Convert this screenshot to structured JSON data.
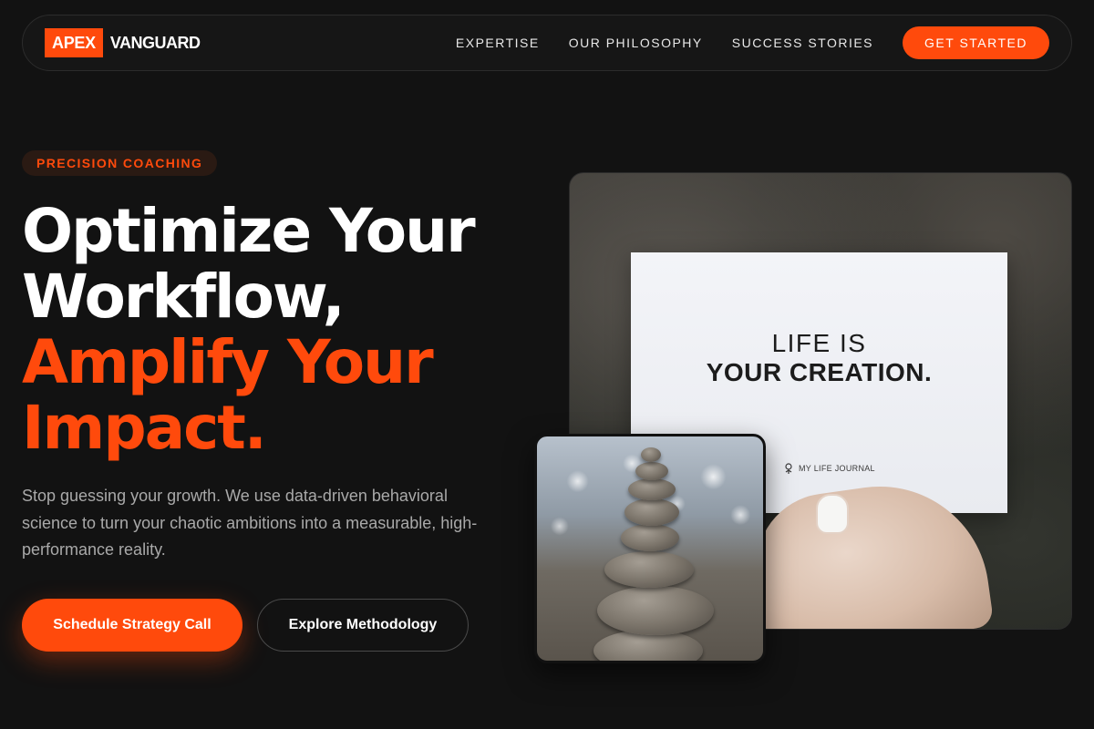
{
  "nav": {
    "logo_mark": "APEX",
    "logo_word": "VANGUARD",
    "links": [
      "EXPERTISE",
      "OUR PHILOSOPHY",
      "SUCCESS STORIES"
    ],
    "cta": "GET STARTED"
  },
  "hero": {
    "badge": "PRECISION COACHING",
    "headline": {
      "line1": "Optimize Your",
      "line2": "Workflow,",
      "line3": "Amplify Your",
      "line4": "Impact."
    },
    "lead": "Stop guessing your growth. We use data-driven behavioral science to turn your chaotic ambitions into a measurable, high-performance reality.",
    "primary_button": "Schedule Strategy Call",
    "secondary_button": "Explore Methodology"
  },
  "images": {
    "card_line1": "LIFE IS",
    "card_line2": "YOUR CREATION.",
    "card_brand": "MY LIFE JOURNAL"
  },
  "colors": {
    "accent": "#ff4a0c",
    "background": "#121212",
    "muted_text": "#a9a9a9"
  },
  "icons": [
    "journal-logo-icon"
  ]
}
